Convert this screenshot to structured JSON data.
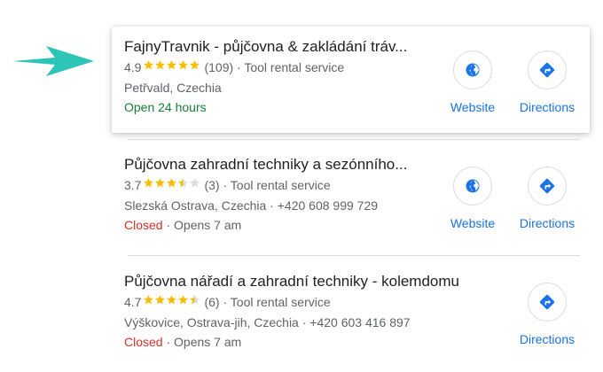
{
  "colors": {
    "accent": "#1a73e8",
    "star": "#fbbc04",
    "open": "#188038",
    "closed": "#d93025",
    "arrow": "#2ec4b6"
  },
  "listings": [
    {
      "title": "FajnyTravnik - půjčovna & zakládání tráv...",
      "rating": "4.9",
      "stars": 5,
      "reviews": "(109)",
      "category": "Tool rental service",
      "address": "Petřvald, Czechia",
      "phone": "",
      "status": "Open 24 hours",
      "status_detail": "",
      "website_label": "Website",
      "directions_label": "Directions"
    },
    {
      "title": "Půjčovna zahradní techniky a sezónního...",
      "rating": "3.7",
      "stars": 3.5,
      "reviews": "(3)",
      "category": "Tool rental service",
      "address": "Slezská Ostrava, Czechia",
      "phone": "+420 608 999 729",
      "status": "Closed",
      "status_detail": "Opens 7 am",
      "website_label": "Website",
      "directions_label": "Directions"
    },
    {
      "title": "Půjčovna nářadí a zahradní techniky - kolemdomu",
      "rating": "4.7",
      "stars": 4.5,
      "reviews": "(6)",
      "category": "Tool rental service",
      "address": "Výškovice, Ostrava-jih, Czechia",
      "phone": "+420 603 416 897",
      "status": "Closed",
      "status_detail": "Opens 7 am",
      "website_label": "",
      "directions_label": "Directions"
    }
  ]
}
